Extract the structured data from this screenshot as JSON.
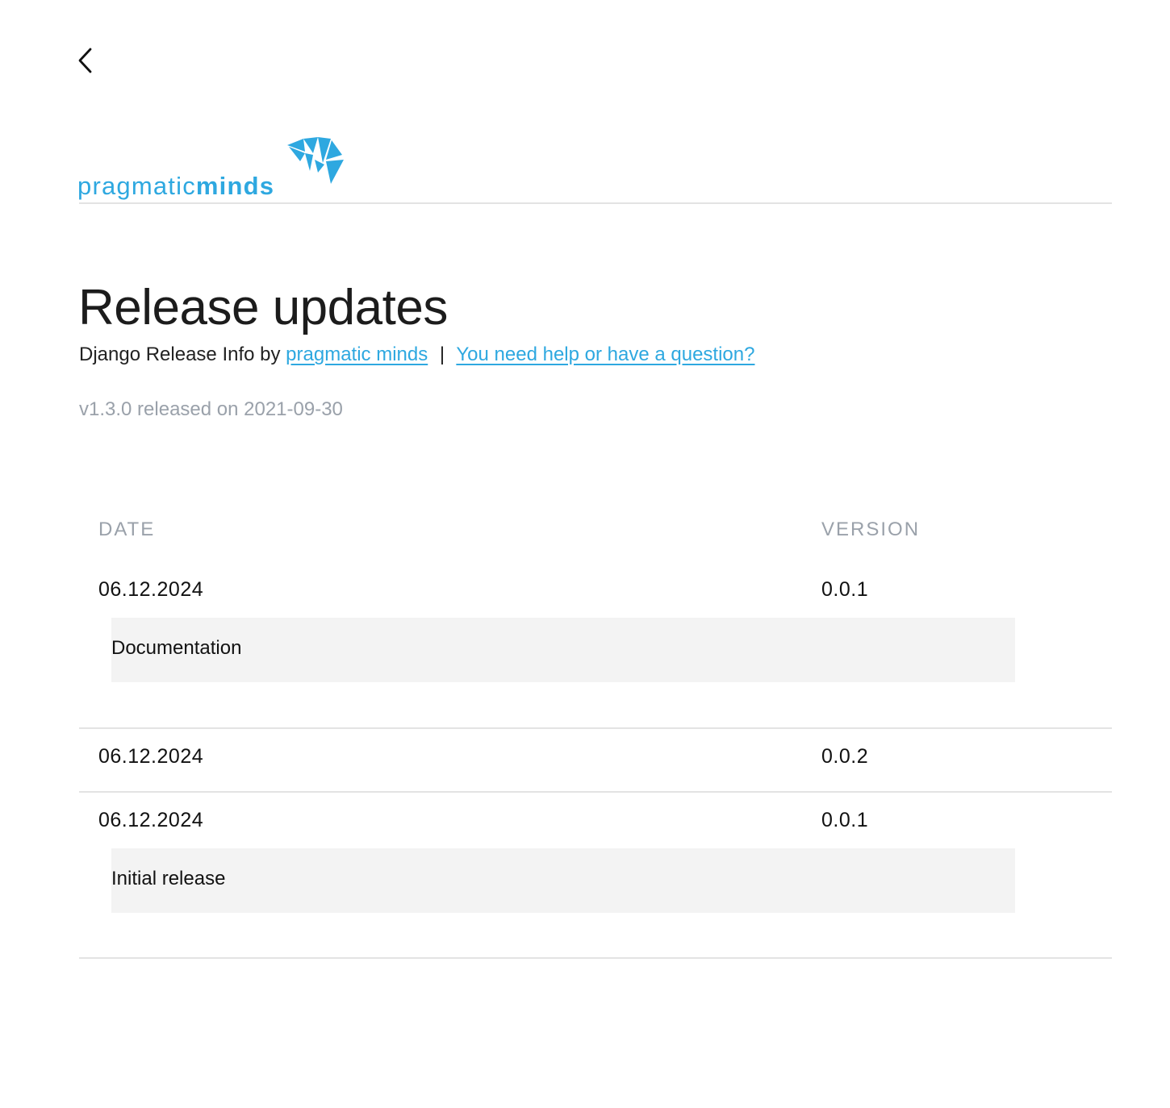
{
  "nav": {
    "back_label": "Back"
  },
  "logo": {
    "text_light": "pragmatic",
    "text_bold": "minds",
    "color": "#2ea8e0"
  },
  "header": {
    "title": "Release updates",
    "subtitle_prefix": "Django Release Info by",
    "brand_link": "pragmatic minds",
    "separator": "|",
    "help_link": "You need help or have a question?",
    "version_info": "v1.3.0 released on 2021-09-30"
  },
  "table": {
    "columns": {
      "date": "DATE",
      "version": "VERSION"
    },
    "rows": [
      {
        "date": "06.12.2024",
        "version": "0.0.1",
        "notes": "Documentation"
      },
      {
        "date": "06.12.2024",
        "version": "0.0.2",
        "notes": ""
      },
      {
        "date": "06.12.2024",
        "version": "0.0.1",
        "notes": "Initial release"
      }
    ]
  },
  "colors": {
    "accent": "#2ea8e0",
    "muted": "#9aa1aa",
    "notes_bg": "#f3f3f3",
    "rule": "#e3e3e3"
  }
}
